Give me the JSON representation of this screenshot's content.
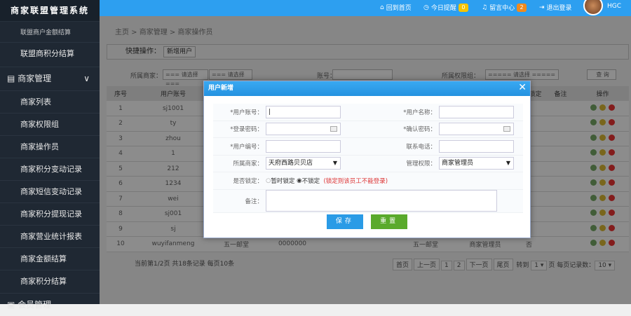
{
  "app": {
    "title": "商家联盟管理系统"
  },
  "sidebar": {
    "items": [
      {
        "label": "联盟商户金额结算"
      },
      {
        "label": "联盟商积分结算"
      },
      {
        "label": "商家管理",
        "group": true
      },
      {
        "label": "商家列表"
      },
      {
        "label": "商家权限组"
      },
      {
        "label": "商家操作员"
      },
      {
        "label": "商家积分变动记录"
      },
      {
        "label": "商家短信变动记录"
      },
      {
        "label": "商家积分提现记录"
      },
      {
        "label": "商家营业统计报表"
      },
      {
        "label": "商家金额结算"
      },
      {
        "label": "商家积分结算"
      },
      {
        "label": "会员管理",
        "group": true
      }
    ]
  },
  "header": {
    "home": "回到首页",
    "remind": "今日提醒",
    "remind_count": "0",
    "messages": "留言中心",
    "messages_count": "2",
    "logout": "退出登录",
    "user": "HGC"
  },
  "breadcrumb": "主页 > 商家管理 > 商家操作员",
  "quick": {
    "label": "快捷操作：",
    "add_user": "新增用户"
  },
  "filter": {
    "merchant_label": "所属商家：",
    "select1": "=== 请选择 ===",
    "select2": "=== 请选择 ===",
    "account_label": "账号：",
    "group_label": "所属权限组：",
    "group_select": "===== 请选择 =====",
    "search": "查 询"
  },
  "table": {
    "headers": [
      "序号",
      "用户账号",
      "",
      "",
      "",
      "",
      "",
      "是否锁定",
      "备注",
      "操作"
    ],
    "rows": [
      [
        "1",
        "sj1001"
      ],
      [
        "2",
        "ty"
      ],
      [
        "3",
        "zhou"
      ],
      [
        "4",
        "1"
      ],
      [
        "5",
        "212"
      ],
      [
        "6",
        "1234"
      ],
      [
        "7",
        "wei"
      ],
      [
        "8",
        "sj001"
      ],
      [
        "9",
        "sj"
      ],
      [
        "10",
        "wuyifanmeng",
        "五一邮堂",
        "0000000",
        "",
        "五一邮堂",
        "商家管理员",
        "否",
        ""
      ]
    ]
  },
  "pager": {
    "summary": "当前第1/2页 共18条记录 每页10条",
    "first": "首页",
    "prev": "上一页",
    "p1": "1",
    "p2": "2",
    "next": "下一页",
    "last": "尾页",
    "goto": "转到",
    "goto_val": "1 ▾",
    "page_unit": "页",
    "per_page_label": "每页记录数：",
    "per_page": "10 ▾"
  },
  "modal": {
    "title": "用户新增",
    "account": "*用户账号：",
    "name": "*用户名称：",
    "password": "*登录密码：",
    "confirm": "*确认密码：",
    "number": "*用户编号：",
    "phone": "联系电话：",
    "merchant": "所属商家：",
    "merchant_val": "天府西路贝贝店",
    "perm": "管理权限：",
    "perm_val": "商家管理员",
    "lock": "是否锁定：",
    "lock_opt1": "暂时锁定",
    "lock_opt2": "不锁定",
    "lock_note": "(锁定则该员工不能登录)",
    "remark": "备注：",
    "save": "保存",
    "reset": "重置"
  },
  "colors": {
    "header": "#2d9ff0",
    "sidebar": "#1f2833",
    "save": "#2a9be6",
    "reset": "#5aaa2c"
  }
}
